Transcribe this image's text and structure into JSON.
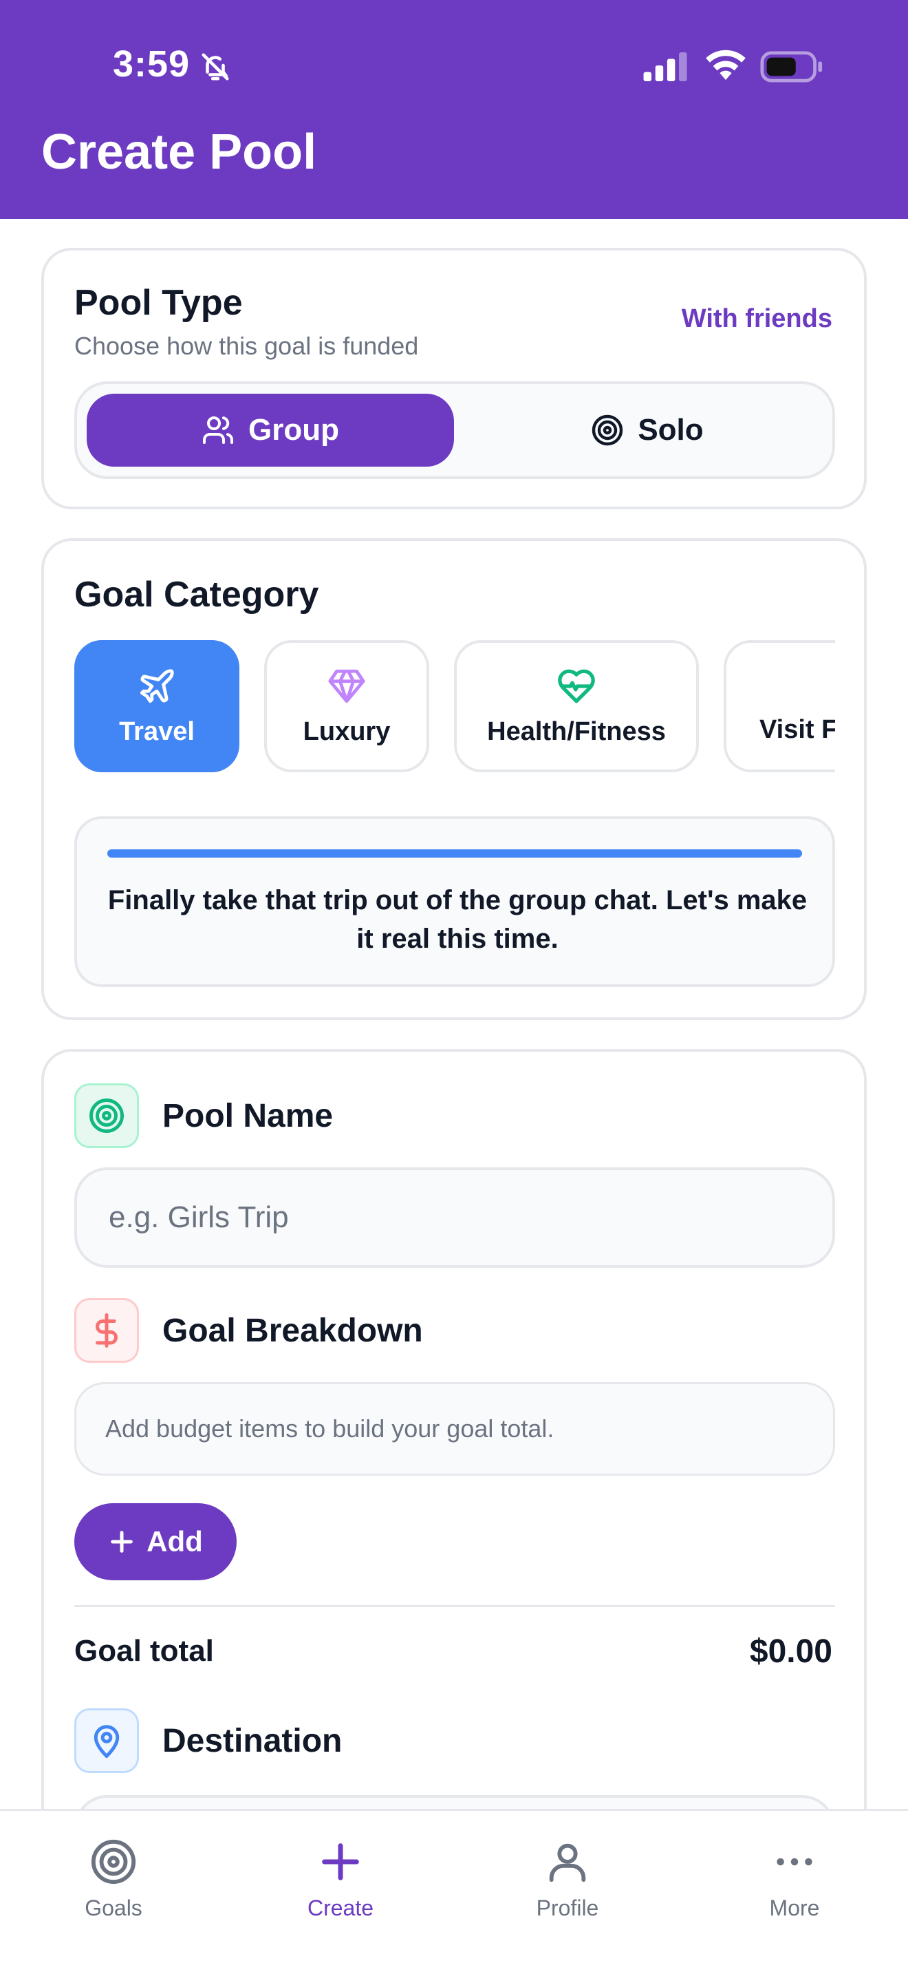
{
  "status_bar": {
    "time": "3:59"
  },
  "header": {
    "title": "Create Pool"
  },
  "pool_type": {
    "title": "Pool Type",
    "subtitle": "Choose how this goal is funded",
    "mode_label": "With friends",
    "options": [
      {
        "label": "Group",
        "icon": "users-icon",
        "selected": true
      },
      {
        "label": "Solo",
        "icon": "target-icon",
        "selected": false
      }
    ]
  },
  "goal_category": {
    "title": "Goal Category",
    "categories": [
      {
        "label": "Travel",
        "icon": "airplane-icon",
        "selected": true
      },
      {
        "label": "Luxury",
        "icon": "diamond-icon",
        "selected": false
      },
      {
        "label": "Health/Fitness",
        "icon": "heart-pulse-icon",
        "selected": false
      },
      {
        "label": "Visit F",
        "icon": "",
        "selected": false
      }
    ],
    "description": "Finally take that trip out of the group chat. Let's make it real this time."
  },
  "form": {
    "pool_name": {
      "label": "Pool Name",
      "value": "",
      "placeholder": "e.g. Girls Trip"
    },
    "goal_breakdown": {
      "label": "Goal Breakdown",
      "empty_text": "Add budget items to build your goal total.",
      "add_label": "Add"
    },
    "goal_total": {
      "label": "Goal total",
      "value": "$0.00"
    },
    "destination": {
      "label": "Destination"
    }
  },
  "tabbar": {
    "items": [
      {
        "label": "Goals",
        "icon": "target-icon",
        "active": false
      },
      {
        "label": "Create",
        "icon": "plus-icon",
        "active": true
      },
      {
        "label": "Profile",
        "icon": "person-icon",
        "active": false
      },
      {
        "label": "More",
        "icon": "more-icon",
        "active": false
      }
    ]
  },
  "colors": {
    "brand_purple": "#6c3bc1",
    "travel_blue": "#4285f4",
    "luxury_purple": "#c084fc",
    "health_green": "#10b981",
    "money_red": "#f87171"
  }
}
